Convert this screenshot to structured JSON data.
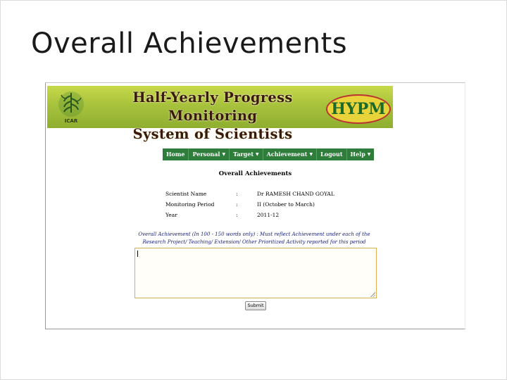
{
  "slide": {
    "title": "Overall Achievements"
  },
  "banner": {
    "title_line1": "Half-Yearly Progress Monitoring",
    "title_line2": "System of Scientists",
    "logo_caption": "ICAR",
    "hypm_logo_text": "HYPM"
  },
  "nav": {
    "items": [
      {
        "label": "Home",
        "has_dropdown": false
      },
      {
        "label": "Personal",
        "has_dropdown": true
      },
      {
        "label": "Target",
        "has_dropdown": true
      },
      {
        "label": "Achievement",
        "has_dropdown": true
      },
      {
        "label": "Logout",
        "has_dropdown": false
      },
      {
        "label": "Help",
        "has_dropdown": true
      }
    ],
    "dropdown_glyph": "▼"
  },
  "page": {
    "heading": "Overall Achievements",
    "info": [
      {
        "label": "Scientist Name",
        "colon": ":",
        "value": "Dr RAMESH CHAND GOYAL"
      },
      {
        "label": "Monitoring Period",
        "colon": ":",
        "value": "II (October to March)"
      },
      {
        "label": "Year",
        "colon": ":",
        "value": "2011-12"
      }
    ],
    "instruction_line1": "Overall Achievement (In 100 - 150 words only) : Must reflect Achievement under each of the",
    "instruction_line2": "Research Project/ Teaching/ Extension/ Other Prioritized Activity reported for this period",
    "textarea_value": "",
    "submit_label": "Submit"
  },
  "colors": {
    "nav_bg": "#2e7d3a",
    "banner_green": "#a8c23c",
    "instruction_text": "#1a237e",
    "textarea_border": "#d4b44a"
  }
}
